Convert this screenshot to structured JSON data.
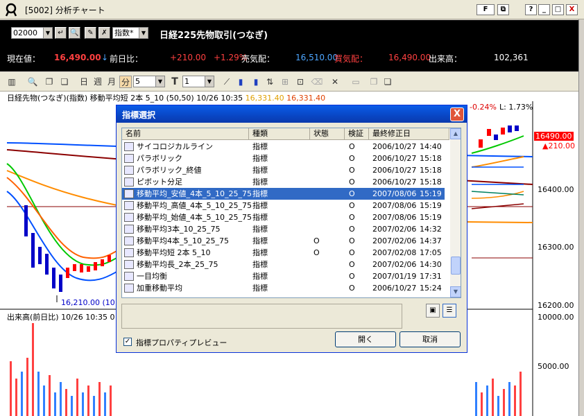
{
  "window": {
    "title": "[5002] 分析チャート",
    "btn_f": "F",
    "btn_help": "?",
    "btn_min": "_",
    "btn_max": "□",
    "btn_close": "X"
  },
  "header": {
    "code_value": "02000",
    "indicator_select": "指数*",
    "symbol_name": "日経225先物取引(つなぎ)",
    "quotes": {
      "current_label": "現在値：",
      "current_value": "16,490.00",
      "current_arrow": "↓",
      "prev_label": "前日比：",
      "change_value": "+210.00",
      "change_pct": "+1.29%",
      "ask_label": "売気配：",
      "ask_value": "16,510.00",
      "bid_label": "買気配：",
      "bid_value": "16,490.00",
      "volume_label": "出来高：",
      "volume_value": "102,361"
    }
  },
  "toolbar": {
    "day_label": "日",
    "week_label": "週",
    "month_label": "月",
    "minute_label": "分",
    "period_value": "5",
    "t_label": "T",
    "t_value": "1"
  },
  "chart": {
    "info_line": "日経先物(つなぎ)(指数) 移動平均短 2本 5_10 (50,50) 10/26 10:35",
    "ma1_value": "16,331.40",
    "ma2_value": "16,331.40",
    "right_pct": "-0.24%",
    "right_l": "L: 1.73%",
    "price_box": "16490.00",
    "price_change": "▲210.00",
    "price_labels": [
      "16400.00",
      "16300.00",
      "16200.00"
    ],
    "low_annotation": "16,210.00 (10",
    "volume_info": "出来高(前日比) 10/26 10:35 0",
    "volume_labels": [
      "10000.00",
      "5000.00"
    ],
    "colors": {
      "ma_short": "#00c800",
      "ma_long": "#ff8c00",
      "ma3": "#0050ff",
      "ma4": "#8b0000",
      "up": "#ff0000",
      "down": "#0000c8",
      "vol_up": "#ff4040",
      "vol_down": "#3080ff"
    }
  },
  "dialog": {
    "title": "指標選択",
    "close": "X",
    "columns": [
      "名前",
      "種類",
      "状態",
      "検証",
      "最終修正日"
    ],
    "rows": [
      {
        "name": "サイコロジカルライン",
        "type": "指標",
        "state": "",
        "verify": "O",
        "date": "2006/10/27",
        "time": "14:40"
      },
      {
        "name": "パラボリック",
        "type": "指標",
        "state": "",
        "verify": "O",
        "date": "2006/10/27",
        "time": "15:18"
      },
      {
        "name": "パラボリック_終値",
        "type": "指標",
        "state": "",
        "verify": "O",
        "date": "2006/10/27",
        "time": "15:18"
      },
      {
        "name": "ピボット分足",
        "type": "指標",
        "state": "",
        "verify": "O",
        "date": "2006/10/27",
        "time": "15:18"
      },
      {
        "name": "移動平均_安値_4本_5_10_25_75",
        "type": "指標",
        "state": "",
        "verify": "O",
        "date": "2007/08/06",
        "time": "15:19"
      },
      {
        "name": "移動平均_高値_4本_5_10_25_75",
        "type": "指標",
        "state": "",
        "verify": "O",
        "date": "2007/08/06",
        "time": "15:19"
      },
      {
        "name": "移動平均_始値_4本_5_10_25_75",
        "type": "指標",
        "state": "",
        "verify": "O",
        "date": "2007/08/06",
        "time": "15:19"
      },
      {
        "name": "移動平均3本_10_25_75",
        "type": "指標",
        "state": "",
        "verify": "O",
        "date": "2007/02/06",
        "time": "14:32"
      },
      {
        "name": "移動平均4本_5_10_25_75",
        "type": "指標",
        "state": "O",
        "verify": "O",
        "date": "2007/02/06",
        "time": "14:37"
      },
      {
        "name": "移動平均短 2本 5_10",
        "type": "指標",
        "state": "O",
        "verify": "O",
        "date": "2007/02/08",
        "time": "17:05"
      },
      {
        "name": "移動平均長_2本_25_75",
        "type": "指標",
        "state": "",
        "verify": "O",
        "date": "2007/02/06",
        "time": "14:30"
      },
      {
        "name": "一目均衡",
        "type": "指標",
        "state": "",
        "verify": "O",
        "date": "2007/01/19",
        "time": "17:31"
      },
      {
        "name": "加重移動平均",
        "type": "指標",
        "state": "",
        "verify": "O",
        "date": "2006/10/27",
        "time": "15:24"
      }
    ],
    "selected_index": 4,
    "preview_label": "指標プロパティプレビュー",
    "preview_checked": "✓",
    "open_button": "開く",
    "cancel_button": "取消"
  }
}
